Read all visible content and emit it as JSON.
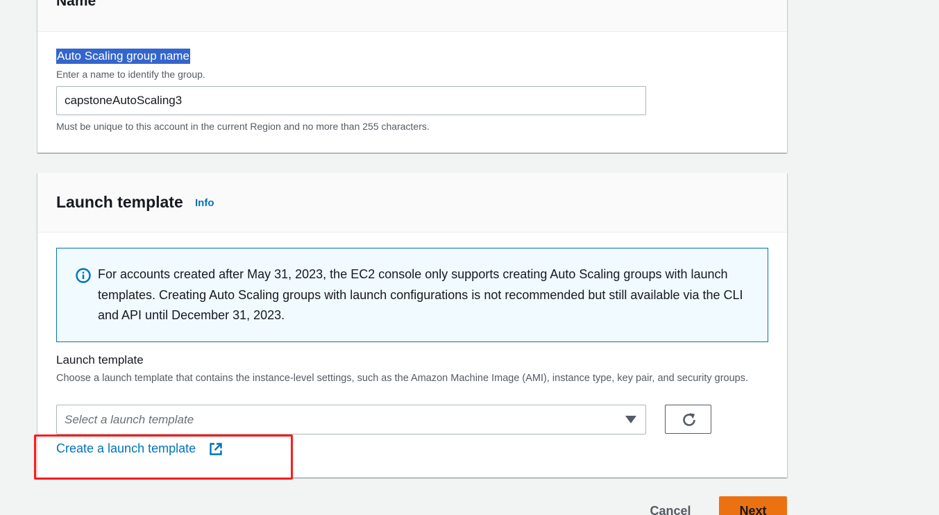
{
  "name_section": {
    "title": "Name",
    "field_label": "Auto Scaling group name",
    "field_description": "Enter a name to identify the group.",
    "input_value": "capstoneAutoScaling3",
    "constraint": "Must be unique to this account in the current Region and no more than 255 characters."
  },
  "launch_template_section": {
    "title": "Launch template",
    "info_link": "Info",
    "alert_text": "For accounts created after May 31, 2023, the EC2 console only supports creating Auto Scaling groups with launch templates. Creating Auto Scaling groups with launch configurations is not recommended but still available via the CLI and API until December 31, 2023.",
    "field_label": "Launch template",
    "field_description": "Choose a launch template that contains the instance-level settings, such as the Amazon Machine Image (AMI), instance type, key pair, and security groups.",
    "select_placeholder": "Select a launch template",
    "create_link": "Create a launch template"
  },
  "footer": {
    "cancel_label": "Cancel",
    "next_label": "Next"
  },
  "colors": {
    "link": "#0073bb",
    "primary_button": "#ec7211",
    "annotation_box": "#ff1a1a",
    "selection": "#3366cc"
  },
  "icons": {
    "alert": "info-circle-icon",
    "refresh": "refresh-icon",
    "external_link": "external-link-icon",
    "dropdown": "caret-down-icon"
  }
}
